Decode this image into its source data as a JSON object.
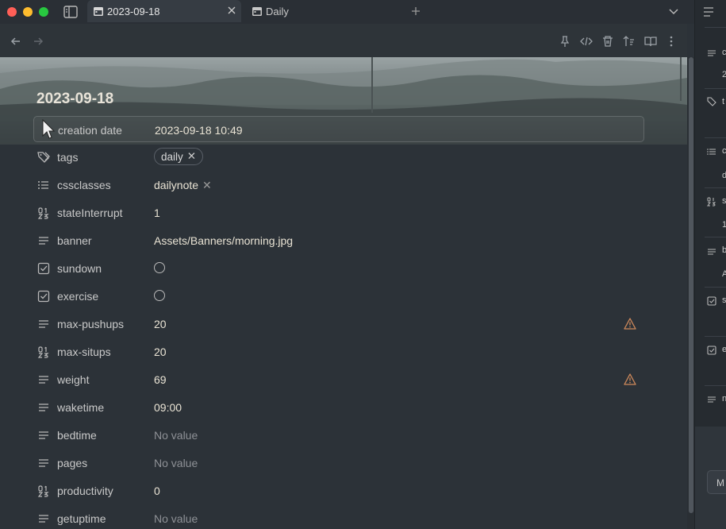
{
  "window": {
    "tabs": [
      {
        "label": "2023-09-18",
        "active": true
      },
      {
        "label": "Daily",
        "active": false
      }
    ]
  },
  "note": {
    "title": "2023-09-18",
    "properties": [
      {
        "key": "creation date",
        "value": "2023-09-18 10:49",
        "type": "date",
        "icon": "calendar-icon"
      },
      {
        "key": "tags",
        "value": "daily",
        "type": "tag-pill",
        "icon": "tags-icon"
      },
      {
        "key": "cssclasses",
        "value": "dailynote",
        "type": "tag-flat",
        "icon": "list-icon"
      },
      {
        "key": "stateInterrupt",
        "value": "1",
        "type": "number",
        "icon": "number-icon"
      },
      {
        "key": "banner",
        "value": "Assets/Banners/morning.jpg",
        "type": "text",
        "icon": "text-icon"
      },
      {
        "key": "sundown",
        "value": "",
        "type": "checkbox",
        "icon": "checkbox-icon"
      },
      {
        "key": "exercise",
        "value": "",
        "type": "checkbox",
        "icon": "checkbox-icon"
      },
      {
        "key": "max-pushups",
        "value": "20",
        "type": "text",
        "icon": "text-icon",
        "warning": true
      },
      {
        "key": "max-situps",
        "value": "20",
        "type": "number",
        "icon": "number-icon"
      },
      {
        "key": "weight",
        "value": "69",
        "type": "text",
        "icon": "text-icon",
        "warning": true
      },
      {
        "key": "waketime",
        "value": "09:00",
        "type": "text",
        "icon": "text-icon"
      },
      {
        "key": "bedtime",
        "value": "No value",
        "type": "empty",
        "icon": "text-icon"
      },
      {
        "key": "pages",
        "value": "No value",
        "type": "empty",
        "icon": "text-icon"
      },
      {
        "key": "productivity",
        "value": "0",
        "type": "number",
        "icon": "number-icon"
      },
      {
        "key": "getuptime",
        "value": "No value",
        "type": "empty",
        "icon": "text-icon"
      }
    ]
  },
  "right_panel": {
    "fragments": [
      "c",
      "2",
      "t",
      "c",
      "d",
      "s",
      "1",
      "b",
      "A",
      "s",
      "e",
      "n",
      "M"
    ]
  },
  "colors": {
    "accent_warning": "#d08a5b",
    "background": "#2c3238",
    "text": "#e9e3d4"
  }
}
